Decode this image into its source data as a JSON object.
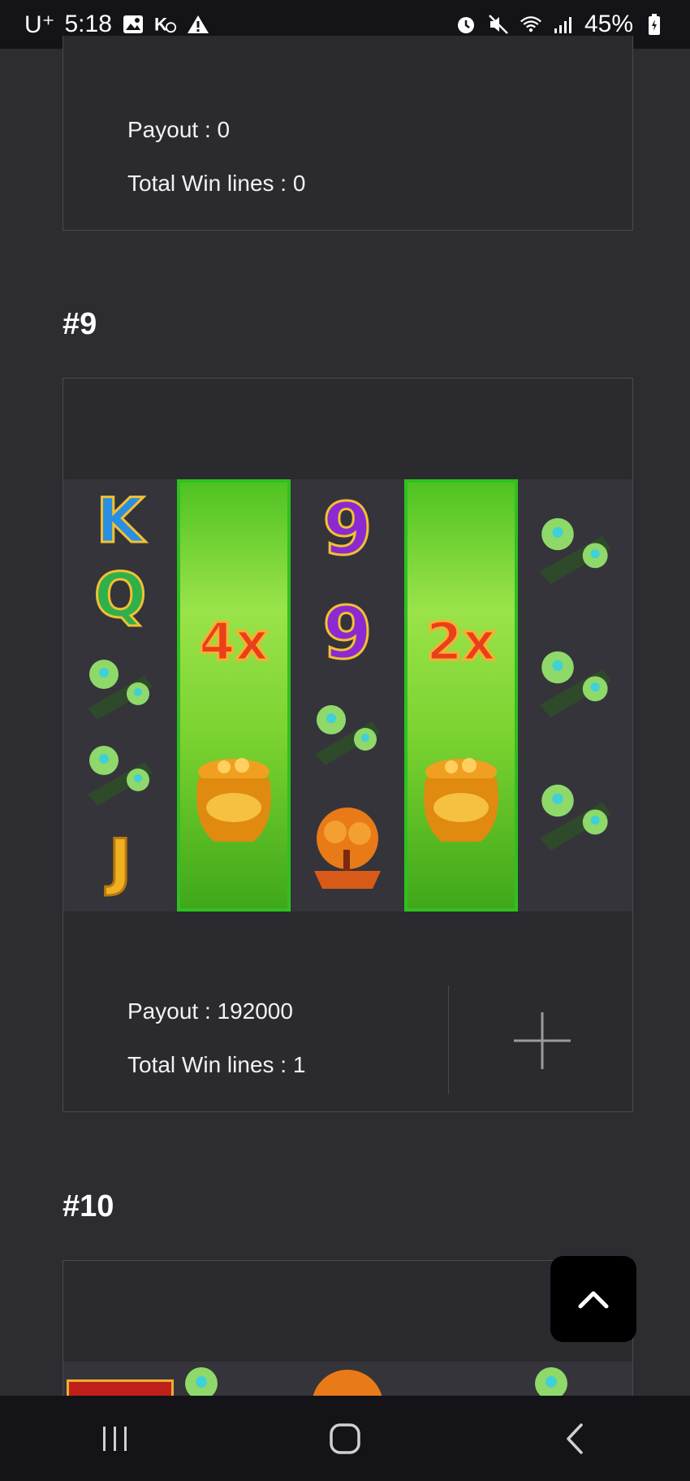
{
  "status_bar": {
    "carrier": "U⁺",
    "time": "5:18",
    "battery": "45%"
  },
  "prev_result": {
    "payout": "Payout : 0",
    "win_lines": "Total Win lines : 0"
  },
  "result_9": {
    "title": "#9",
    "payout": "Payout : 192000",
    "win_lines": "Total Win lines : 1",
    "reels": [
      [
        "K",
        "Q",
        "jade-ruyi",
        "jade-ruyi",
        "J"
      ],
      [
        "4x",
        "gold-pot"
      ],
      [
        "9",
        "9",
        "jade-ruyi",
        "money-tree"
      ],
      [
        "2x",
        "gold-pot"
      ],
      [
        "jade-ruyi",
        "jade-ruyi",
        "jade-ruyi"
      ]
    ]
  },
  "result_10": {
    "title": "#10"
  },
  "colors": {
    "background": "#2d2c30",
    "card": "#2b2a2e",
    "wild_green": "#4fc322"
  }
}
